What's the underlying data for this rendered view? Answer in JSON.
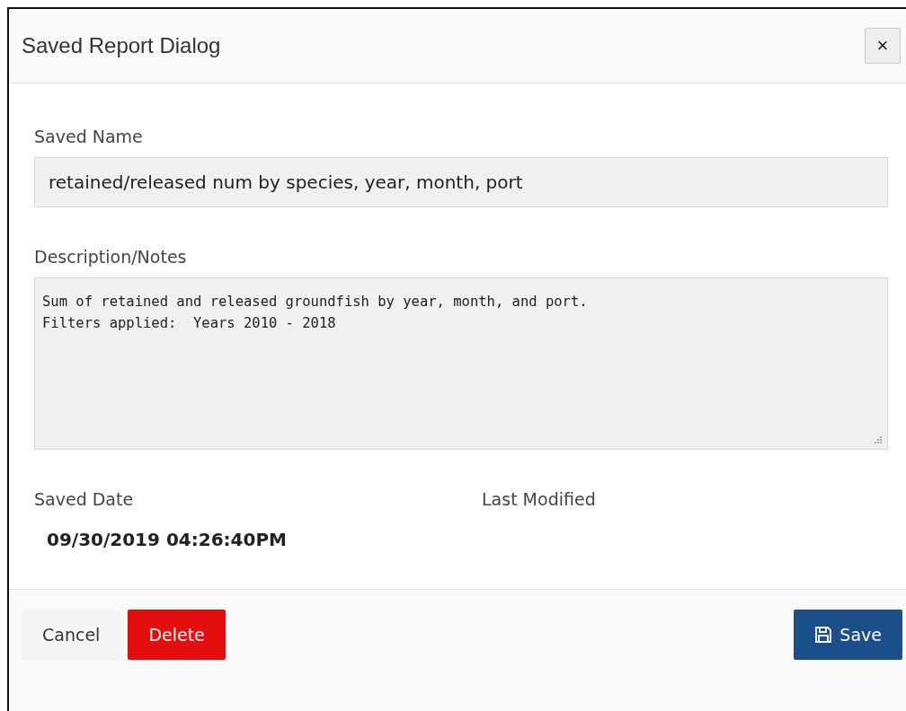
{
  "dialog": {
    "title": "Saved Report Dialog",
    "close": "×"
  },
  "fields": [
    {
      "kind": "input",
      "label": "Saved Name",
      "value": "retained/released num by species, year, month, port"
    },
    {
      "kind": "textarea",
      "label": "Description/Notes",
      "value": "Sum of retained and released groundfish by year, month, and port.\nFilters applied:  Years 2010 - 2018"
    }
  ],
  "dates": [
    {
      "label": "Saved Date",
      "value": "09/30/2019 04:26:40PM"
    },
    {
      "label": "Last Modified"
    }
  ],
  "buttons": [
    {
      "kind": "plain",
      "label": "Cancel"
    },
    {
      "kind": "danger",
      "label": "Delete"
    },
    {
      "kind": "primary",
      "label": "Save"
    }
  ]
}
